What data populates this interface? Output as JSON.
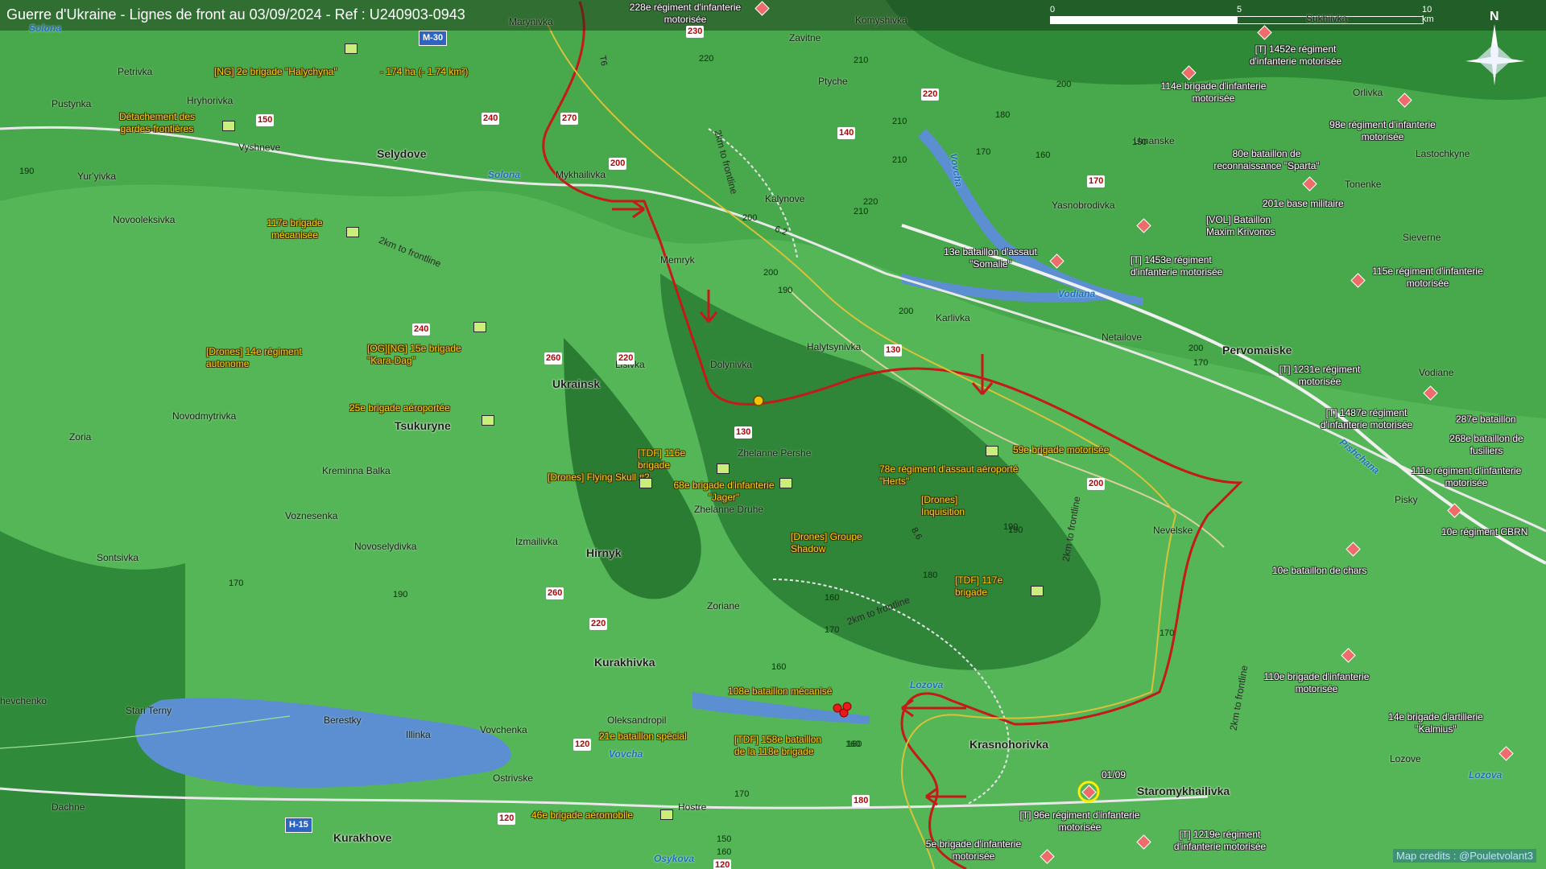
{
  "title": "Guerre d'Ukraine - Lignes de front au 03/09/2024 - Ref : U240903-0943",
  "area_note": "- 174 ha (- 1.74 km²)",
  "date_marker": "01/09",
  "credits": "Map credits : @Pouletvolant3",
  "scale": {
    "ticks": [
      "0",
      "5",
      "10 km"
    ]
  },
  "compass": "N",
  "colors": {
    "frontline": "#c41a1a",
    "ukr_units": "#ffd21a",
    "ru_units": "#f26b6b",
    "water": "#4a8fd8"
  },
  "towns": [
    "Selydove",
    "Ukrainsk",
    "Tsukuryne",
    "Hirnyk",
    "Kurakhivka",
    "Krasnohorivka",
    "Kurakhove",
    "Pervomaiske",
    "Staromykhailivka"
  ],
  "villages": [
    "Marynivka",
    "Petrivka",
    "Pustynka",
    "Hryhorivka",
    "Vyshneve",
    "Yurʼyivka",
    "Novooleksivka",
    "Mykhailivka",
    "Memryk",
    "Lisivka",
    "Dolynivka",
    "Halytsynivka",
    "Kalynove",
    "Ptyche",
    "Zavitne",
    "Komyshivka",
    "Karlivka",
    "Yasnobrodivka",
    "Umanske",
    "Orlivka",
    "Tonenke",
    "Lastochkyne",
    "Sieverne",
    "Netailove",
    "Vodiane",
    "Pisky",
    "Nevelske",
    "Zhelanne Pershe",
    "Zhelanne Druhe",
    "Zoriane",
    "Novodmytrivka",
    "Zoria",
    "Kreminna Balka",
    "Voznesenka",
    "Novoselydivka",
    "Izmailivka",
    "Sontsivka",
    "Oleksandropil",
    "Stari Terny",
    "Berestky",
    "Illinka",
    "Vovchenka",
    "Ostrivske",
    "Hostre",
    "Dachne",
    "hevchenko",
    "Lozove",
    "Sukhiivka"
  ],
  "rivers": [
    "Solona",
    "Solona",
    "Vovcha",
    "Vodiana",
    "Lozova",
    "Lozova",
    "Vovcha",
    "Osykova",
    "Pishchana"
  ],
  "highways": [
    "M-30",
    "H-15"
  ],
  "roads": [
    "230",
    "240",
    "270",
    "200",
    "220",
    "140",
    "170",
    "150",
    "240",
    "260",
    "220",
    "260",
    "220",
    "200",
    "180",
    "130",
    "130",
    "120",
    "120",
    "120"
  ],
  "frontline_labels": [
    "2km to frontline",
    "2km to frontline",
    "2km to frontline",
    "2km to frontline",
    "2km to frontline"
  ],
  "road_refs": [
    "T6",
    "6.2",
    "8.6"
  ],
  "elevations": [
    "190",
    "220",
    "210",
    "200",
    "180",
    "170",
    "160",
    "150",
    "200",
    "210",
    "200",
    "190",
    "210",
    "220",
    "210",
    "200",
    "190",
    "200",
    "160",
    "170",
    "170",
    "160",
    "190",
    "180",
    "170",
    "160",
    "170",
    "190",
    "150",
    "160",
    "170",
    "160"
  ],
  "ua_units": [
    "[NG] 2e brigade \"Halychyna\"",
    "Détachement des gardes-frontières",
    "117e brigade mécanisée",
    "[Drones] 14e régiment autonome",
    "[OG][NG] 15e brigade \"Kara-Dag\"",
    "25e brigade aéroportée",
    "[TDF] 116e brigade",
    "[Drones] Flying Skull #2",
    "68e brigade d'infanterie \"Jager\"",
    "78e régiment d'assaut aéroporté \"Herts\"",
    "[Drones] Inquisition",
    "[Drones] Groupe Shadow",
    "59e brigade motorisée",
    "[TDF] 117e brigade",
    "108e bataillon mécanisé",
    "21e bataillon spécial",
    "[TDF] 158e bataillon de la 118e brigade",
    "46e brigade aéromobile"
  ],
  "ru_units": [
    "228e régiment d'infanterie motorisée",
    "[T] 1452e régiment d'infanterie motorisée",
    "114e brigade d'infanterie motorisée",
    "98e régiment d'infanterie motorisée",
    "80e bataillon de reconnaissance \"Sparta\"",
    "201e base militaire",
    "[VOL] Bataillon Maxim Krivonos",
    "[T] 1453e régiment d'infanterie motorisée",
    "13e bataillon d'assaut \"Somalie\"",
    "115e régiment d'infanterie motorisée",
    "[T] 1231e régiment motorisée",
    "[T] 1487e régiment d'infanterie motorisée",
    "287e bataillon",
    "268e bataillon de fusiliers",
    "111e régiment d'infanterie motorisée",
    "10e régiment CBRN",
    "10e bataillon de chars",
    "110e brigade d'infanterie motorisée",
    "14e brigade d'artillerie \"Kalmius\"",
    "[T] 96e régiment d'infanterie motorisée",
    "[T] 1219e régiment d'infanterie motorisée",
    "5e brigade d'infanterie motorisée"
  ]
}
